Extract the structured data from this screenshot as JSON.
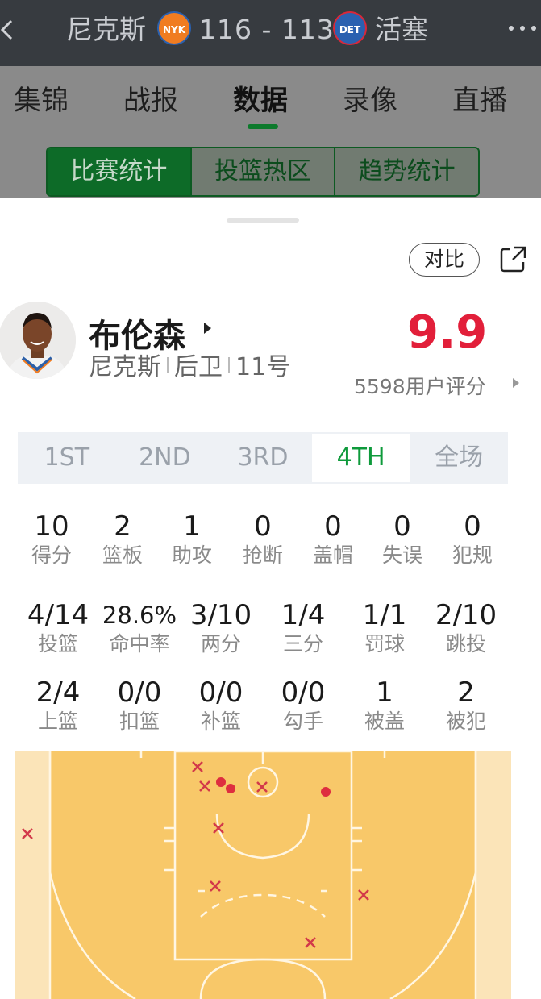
{
  "header": {
    "back_icon": "chevron-left-icon",
    "home_team": "尼克斯",
    "home_logo_text": "NYK",
    "score": "116 - 113",
    "away_logo_text": "DET",
    "away_team": "活塞",
    "more_icon": "more-dots-icon"
  },
  "tabs": [
    {
      "label": "集锦"
    },
    {
      "label": "战报"
    },
    {
      "label": "数据"
    },
    {
      "label": "录像"
    },
    {
      "label": "直播"
    }
  ],
  "active_tab": "数据",
  "sub_tabs": [
    {
      "label": "比赛统计"
    },
    {
      "label": "投篮热区"
    },
    {
      "label": "趋势统计"
    }
  ],
  "actions": {
    "compare_label": "对比",
    "share_icon": "share-icon"
  },
  "player": {
    "name": "布伦森",
    "team": "尼克斯",
    "position": "后卫",
    "number": "11号",
    "rating": "9.9",
    "rating_count": "5598用户评分"
  },
  "quarters": [
    "1ST",
    "2ND",
    "3RD",
    "4TH",
    "全场"
  ],
  "active_quarter": "4TH",
  "stats_row1": [
    {
      "value": "10",
      "label": "得分"
    },
    {
      "value": "2",
      "label": "篮板"
    },
    {
      "value": "1",
      "label": "助攻"
    },
    {
      "value": "0",
      "label": "抢断"
    },
    {
      "value": "0",
      "label": "盖帽"
    },
    {
      "value": "0",
      "label": "失误"
    },
    {
      "value": "0",
      "label": "犯规"
    }
  ],
  "stats_row2": [
    {
      "value": "4/14",
      "label": "投篮"
    },
    {
      "value": "28.6%",
      "label": "命中率"
    },
    {
      "value": "3/10",
      "label": "两分"
    },
    {
      "value": "1/4",
      "label": "三分"
    },
    {
      "value": "1/1",
      "label": "罚球"
    },
    {
      "value": "2/10",
      "label": "跳投"
    }
  ],
  "stats_row3": [
    {
      "value": "2/4",
      "label": "上篮"
    },
    {
      "value": "0/0",
      "label": "扣篮"
    },
    {
      "value": "0/0",
      "label": "补篮"
    },
    {
      "value": "0/0",
      "label": "勾手"
    },
    {
      "value": "1",
      "label": "被盖"
    },
    {
      "value": "2",
      "label": "被犯"
    }
  ],
  "colors": {
    "accent_green": "#0e9a3b",
    "rating_red": "#e21f3a",
    "court": "#f8c869",
    "made_shot": "#de2e3f",
    "missed_shot": "#d2394a"
  }
}
